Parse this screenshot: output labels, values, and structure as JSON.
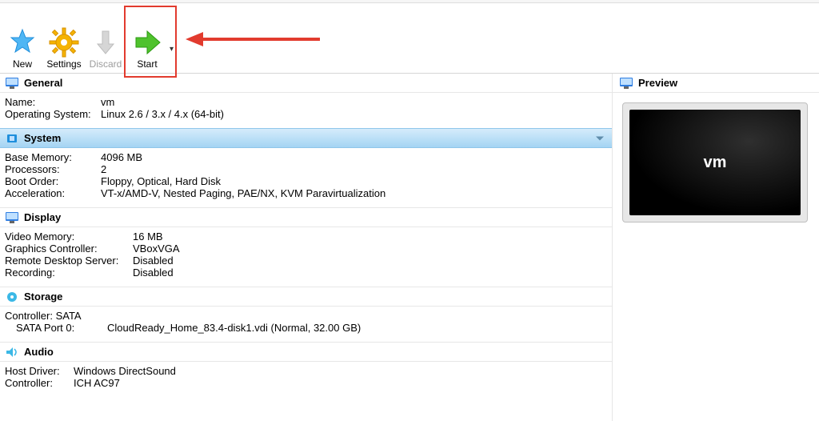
{
  "toolbar": {
    "new_label": "New",
    "settings_label": "Settings",
    "discard_label": "Discard",
    "start_label": "Start"
  },
  "general": {
    "title": "General",
    "name_label": "Name:",
    "name_value": "vm",
    "os_label": "Operating System:",
    "os_value": "Linux 2.6 / 3.x / 4.x (64-bit)"
  },
  "system": {
    "title": "System",
    "base_memory_label": "Base Memory:",
    "base_memory_value": "4096 MB",
    "processors_label": "Processors:",
    "processors_value": "2",
    "boot_order_label": "Boot Order:",
    "boot_order_value": "Floppy, Optical, Hard Disk",
    "acceleration_label": "Acceleration:",
    "acceleration_value": "VT-x/AMD-V, Nested Paging, PAE/NX, KVM Paravirtualization"
  },
  "display": {
    "title": "Display",
    "video_memory_label": "Video Memory:",
    "video_memory_value": "16 MB",
    "graphics_controller_label": "Graphics Controller:",
    "graphics_controller_value": "VBoxVGA",
    "remote_desktop_label": "Remote Desktop Server:",
    "remote_desktop_value": "Disabled",
    "recording_label": "Recording:",
    "recording_value": "Disabled"
  },
  "storage": {
    "title": "Storage",
    "controller_label": "Controller: SATA",
    "port_label": "SATA Port 0:",
    "port_value": "CloudReady_Home_83.4-disk1.vdi (Normal, 32.00 GB)"
  },
  "audio": {
    "title": "Audio",
    "host_driver_label": "Host Driver:",
    "host_driver_value": "Windows DirectSound",
    "controller_label": "Controller:",
    "controller_value": "ICH AC97"
  },
  "preview": {
    "title": "Preview",
    "vm_name": "vm"
  }
}
